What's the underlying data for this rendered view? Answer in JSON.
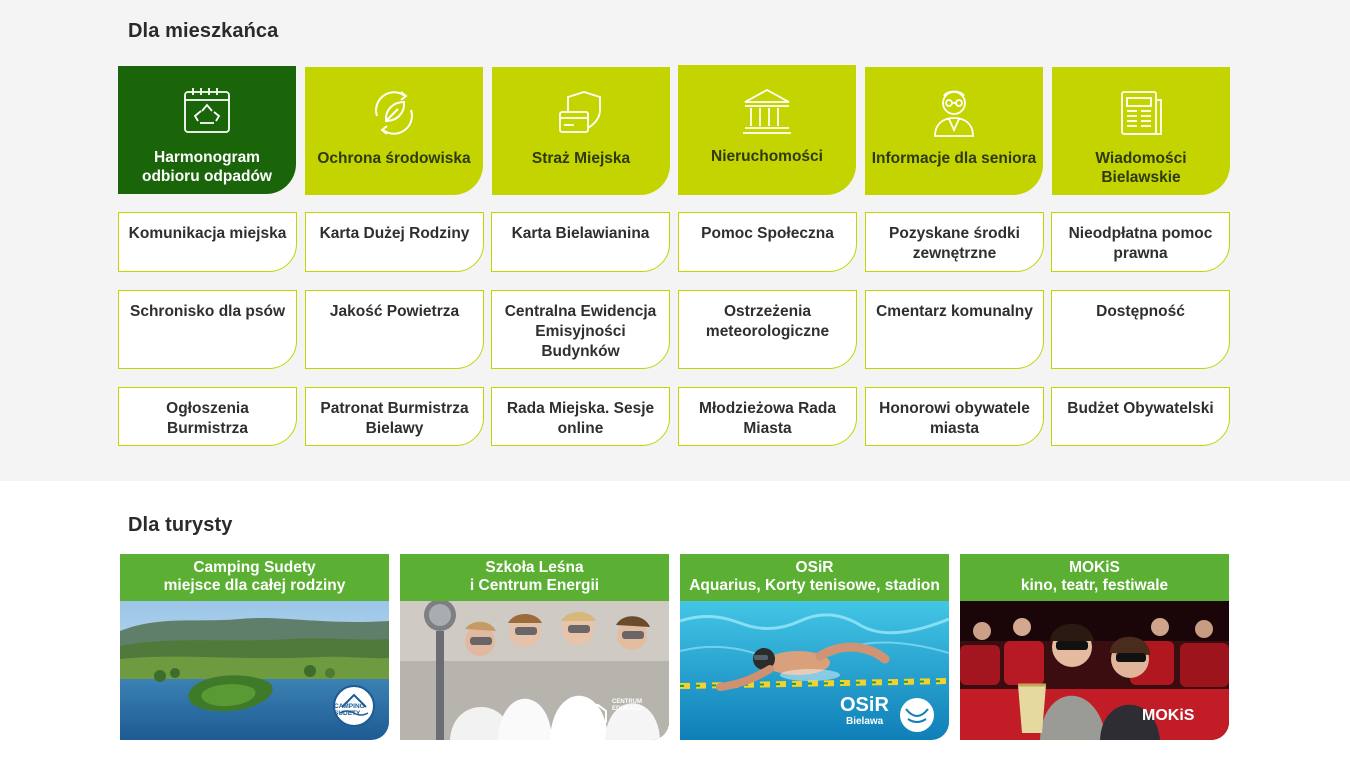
{
  "resident": {
    "title": "Dla mieszkańca",
    "tiles": [
      {
        "label": "Harmonogram odbioru odpadów",
        "icon": "recycle-calendar-icon"
      },
      {
        "label": "Ochrona środowiska",
        "icon": "leaf-cycle-icon"
      },
      {
        "label": "Straż Miejska",
        "icon": "shield-card-icon"
      },
      {
        "label": "Nieruchomości",
        "icon": "building-columns-icon"
      },
      {
        "label": "Informacje dla seniora",
        "icon": "senior-person-icon"
      },
      {
        "label": "Wiadomości Bielawskie",
        "icon": "newspaper-icon"
      }
    ],
    "links": [
      "Komunikacja miejska",
      "Karta Dużej Rodziny",
      "Karta Bielawianina",
      "Pomoc Społeczna",
      "Pozyskane środki zewnętrzne",
      "Nieodpłatna pomoc prawna",
      "Schronisko dla psów",
      "Jakość Powietrza",
      "Centralna Ewidencja Emisyjności Budynków",
      "Ostrzeżenia meteorologiczne",
      "Cmentarz komunalny",
      "Dostępność",
      "Ogłoszenia Burmistrza",
      "Patronat Burmistrza Bielawy",
      "Rada Miejska. Sesje online",
      "Młodzieżowa Rada Miasta",
      "Honorowi obywatele miasta",
      "Budżet Obywatelski"
    ]
  },
  "tourist": {
    "title": "Dla turysty",
    "cards": [
      {
        "line1": "Camping Sudety",
        "line2": "miejsce dla całej rodziny",
        "logo": "CAMPING SUDETY"
      },
      {
        "line1": "Szkoła Leśna",
        "line2": "i Centrum Energii",
        "logo": "CENTRUM EDUKACJI"
      },
      {
        "line1": "OSiR",
        "line2": "Aquarius, Korty tenisowe, stadion",
        "logo": "OSiR",
        "logo_sub": "Bielawa"
      },
      {
        "line1": "MOKiS",
        "line2": "kino, teatr,  festiwale",
        "logo": "MOKiS"
      }
    ]
  },
  "colors": {
    "lime": "#c3d400",
    "dark_green": "#1a640a",
    "card_green": "#5bb033"
  }
}
